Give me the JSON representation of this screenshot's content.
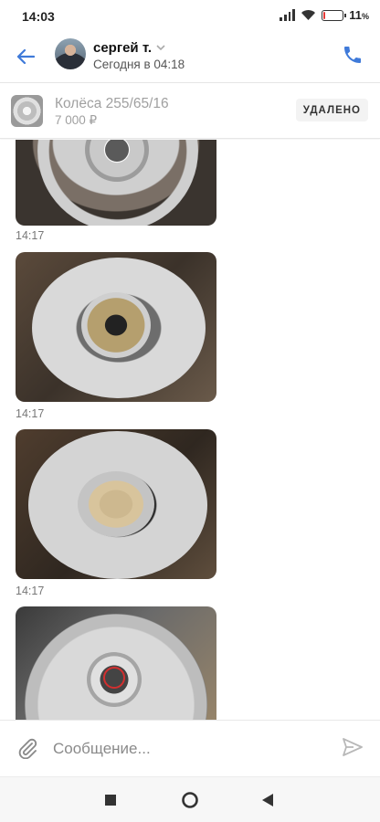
{
  "status_bar": {
    "time": "14:03",
    "battery_text": "11",
    "battery_percent_sign": "%",
    "battery_level": 0.11
  },
  "header": {
    "contact_name": "сергей т.",
    "last_seen": "Сегодня в 04:18"
  },
  "listing": {
    "title": "Колёса 255/65/16",
    "price": "7 000 ₽",
    "status_badge": "УДАЛЕНО"
  },
  "messages": [
    {
      "type": "photo",
      "time": "14:17"
    },
    {
      "type": "photo",
      "time": "14:17"
    },
    {
      "type": "photo",
      "time": "14:17"
    },
    {
      "type": "photo",
      "time": ""
    }
  ],
  "composer": {
    "placeholder": "Сообщение..."
  },
  "icons": {
    "back": "arrow-left-icon",
    "call": "phone-icon",
    "attach": "paperclip-icon",
    "send": "send-icon",
    "nav_recents": "square-icon",
    "nav_home": "circle-icon",
    "nav_back": "triangle-back-icon"
  },
  "colors": {
    "accent": "#3f7ad9",
    "muted_text": "#a0a0a0",
    "battery_low": "#e53935"
  }
}
